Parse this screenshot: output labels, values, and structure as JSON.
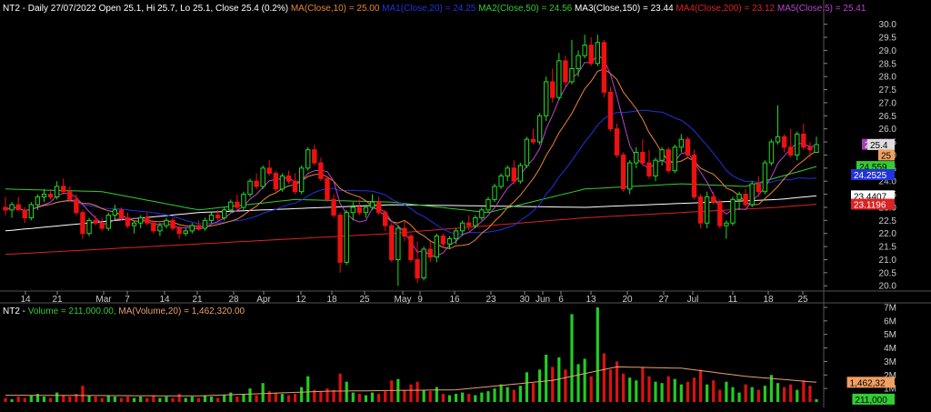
{
  "price_header": {
    "prefix": "NT2 - Daily 27/07/2022 Open 25.1, Hi 25.7, Lo 25.1, Close 25.4 (0.2%)",
    "ma_items": [
      {
        "text": "MA(Close,10) = 25.00",
        "color": "#e8843a"
      },
      {
        "text": "MA1(Close,20) = 24.25",
        "color": "#2233dd"
      },
      {
        "text": "MA2(Close,50) = 24.56",
        "color": "#33cc33"
      },
      {
        "text": "MA3(Close,150) = 23.44",
        "color": "#ffffff"
      },
      {
        "text": "MA4(Close,200) = 23.12",
        "color": "#dd2222"
      },
      {
        "text": "MA5(Close,5) = 25.41",
        "color": "#bb44cc"
      }
    ]
  },
  "volume_header": {
    "prefix": "NT2 - ",
    "items": [
      {
        "text": "Volume = 211,000.00,",
        "color": "#33cc33"
      },
      {
        "text": "MA(Volume,20) = 1,462,320.00",
        "color": "#e8a070"
      }
    ]
  },
  "chart_data": [
    {
      "type": "candlestick",
      "title": "NT2 - Daily",
      "x_tick_labels": [
        "14",
        "21",
        "Mar",
        "7",
        "14",
        "21",
        "28",
        "Apr",
        "12",
        "18",
        "25",
        "May",
        "9",
        "16",
        "23",
        "30",
        "Jun",
        "6",
        "13",
        "20",
        "27",
        "Jul",
        "11",
        "18",
        "25"
      ],
      "y_tick_labels": [
        "20.0",
        "20.5",
        "21.0",
        "21.5",
        "22.0",
        "22.5",
        "23.0",
        "23.5",
        "24.0",
        "24.5",
        "25.0",
        "25.5",
        "26.0",
        "26.5",
        "27.0",
        "27.5",
        "28.0",
        "28.5",
        "29.0",
        "29.5",
        "30.0"
      ],
      "ylim": [
        19.8,
        30.3
      ],
      "ohlc": [
        [
          23.0,
          23.4,
          22.7,
          22.9
        ],
        [
          22.9,
          23.2,
          22.6,
          23.1
        ],
        [
          23.1,
          23.4,
          22.9,
          22.9
        ],
        [
          22.9,
          23.0,
          22.4,
          22.6
        ],
        [
          22.6,
          23.2,
          22.5,
          23.1
        ],
        [
          23.1,
          23.5,
          22.9,
          23.4
        ],
        [
          23.4,
          23.7,
          23.2,
          23.5
        ],
        [
          23.5,
          23.7,
          23.3,
          23.4
        ],
        [
          23.4,
          24.0,
          23.3,
          23.8
        ],
        [
          23.8,
          24.1,
          23.5,
          23.6
        ],
        [
          23.6,
          23.8,
          23.2,
          23.3
        ],
        [
          23.3,
          23.5,
          22.7,
          22.8
        ],
        [
          22.8,
          22.9,
          21.8,
          22.0
        ],
        [
          22.0,
          22.6,
          21.9,
          22.5
        ],
        [
          22.5,
          22.7,
          22.3,
          22.4
        ],
        [
          22.4,
          22.6,
          22.1,
          22.2
        ],
        [
          22.2,
          22.8,
          22.1,
          22.7
        ],
        [
          22.7,
          23.1,
          22.5,
          22.9
        ],
        [
          22.9,
          23.0,
          22.5,
          22.6
        ],
        [
          22.6,
          22.8,
          22.2,
          22.3
        ],
        [
          22.3,
          22.5,
          22.0,
          22.4
        ],
        [
          22.4,
          22.7,
          22.2,
          22.6
        ],
        [
          22.6,
          22.8,
          22.3,
          22.4
        ],
        [
          22.4,
          22.5,
          22.0,
          22.1
        ],
        [
          22.1,
          22.4,
          21.9,
          22.3
        ],
        [
          22.3,
          22.6,
          22.2,
          22.5
        ],
        [
          22.5,
          22.6,
          22.1,
          22.2
        ],
        [
          22.2,
          22.3,
          21.8,
          22.0
        ],
        [
          22.0,
          22.2,
          21.9,
          22.1
        ],
        [
          22.1,
          22.4,
          22.0,
          22.3
        ],
        [
          22.3,
          22.5,
          22.1,
          22.2
        ],
        [
          22.2,
          22.6,
          22.1,
          22.5
        ],
        [
          22.5,
          22.8,
          22.4,
          22.7
        ],
        [
          22.7,
          22.9,
          22.5,
          22.6
        ],
        [
          22.6,
          23.0,
          22.5,
          22.9
        ],
        [
          22.9,
          23.3,
          22.8,
          23.2
        ],
        [
          23.2,
          23.5,
          22.9,
          23.0
        ],
        [
          23.0,
          23.6,
          22.9,
          23.5
        ],
        [
          23.5,
          24.1,
          23.4,
          24.0
        ],
        [
          24.0,
          24.3,
          23.7,
          23.8
        ],
        [
          23.8,
          24.6,
          23.7,
          24.5
        ],
        [
          24.5,
          24.8,
          24.2,
          24.3
        ],
        [
          24.3,
          24.4,
          23.6,
          23.7
        ],
        [
          23.7,
          24.3,
          23.6,
          24.2
        ],
        [
          24.2,
          24.4,
          23.9,
          24.0
        ],
        [
          24.0,
          24.3,
          23.5,
          23.6
        ],
        [
          23.6,
          24.6,
          23.5,
          24.5
        ],
        [
          24.5,
          25.3,
          24.4,
          25.2
        ],
        [
          25.2,
          25.4,
          24.6,
          24.7
        ],
        [
          24.7,
          24.9,
          24.0,
          24.1
        ],
        [
          24.1,
          24.2,
          23.2,
          23.3
        ],
        [
          23.3,
          23.5,
          22.6,
          22.7
        ],
        [
          22.7,
          22.8,
          20.5,
          20.9
        ],
        [
          20.9,
          22.9,
          20.8,
          22.8
        ],
        [
          22.8,
          23.2,
          22.5,
          23.0
        ],
        [
          23.0,
          23.3,
          22.7,
          22.8
        ],
        [
          22.8,
          23.1,
          22.6,
          23.0
        ],
        [
          23.0,
          23.5,
          22.9,
          23.2
        ],
        [
          23.2,
          23.4,
          22.7,
          22.8
        ],
        [
          22.8,
          22.9,
          22.1,
          22.3
        ],
        [
          22.3,
          22.4,
          20.9,
          21.0
        ],
        [
          21.0,
          22.3,
          20.0,
          22.2
        ],
        [
          22.2,
          22.5,
          21.7,
          21.9
        ],
        [
          21.9,
          22.0,
          20.9,
          21.0
        ],
        [
          21.0,
          21.7,
          20.1,
          20.3
        ],
        [
          20.3,
          21.5,
          20.2,
          21.4
        ],
        [
          21.4,
          21.7,
          20.9,
          21.1
        ],
        [
          21.1,
          22.0,
          20.9,
          21.9
        ],
        [
          21.9,
          22.0,
          21.5,
          21.6
        ],
        [
          21.6,
          21.9,
          21.4,
          21.8
        ],
        [
          21.8,
          22.2,
          21.6,
          22.1
        ],
        [
          22.1,
          22.5,
          21.9,
          22.4
        ],
        [
          22.4,
          22.7,
          22.1,
          22.3
        ],
        [
          22.3,
          22.7,
          22.2,
          22.6
        ],
        [
          22.6,
          23.0,
          22.5,
          22.9
        ],
        [
          22.9,
          23.4,
          22.8,
          23.3
        ],
        [
          23.3,
          23.9,
          23.2,
          23.8
        ],
        [
          23.8,
          24.3,
          23.7,
          24.2
        ],
        [
          24.2,
          24.6,
          24.0,
          24.5
        ],
        [
          24.5,
          24.8,
          23.9,
          24.0
        ],
        [
          24.0,
          24.7,
          23.9,
          24.6
        ],
        [
          24.6,
          25.7,
          24.5,
          25.6
        ],
        [
          25.6,
          26.0,
          25.4,
          25.5
        ],
        [
          25.5,
          26.6,
          25.4,
          26.5
        ],
        [
          26.5,
          28.0,
          26.3,
          27.8
        ],
        [
          27.8,
          28.3,
          27.0,
          27.2
        ],
        [
          27.2,
          28.9,
          27.1,
          28.6
        ],
        [
          28.6,
          28.8,
          27.6,
          27.8
        ],
        [
          27.8,
          29.4,
          27.7,
          28.3
        ],
        [
          28.3,
          29.0,
          28.0,
          28.8
        ],
        [
          28.8,
          29.6,
          28.7,
          29.2
        ],
        [
          29.2,
          29.5,
          28.4,
          28.5
        ],
        [
          28.5,
          29.6,
          28.4,
          29.3
        ],
        [
          29.3,
          29.4,
          27.2,
          27.4
        ],
        [
          27.4,
          27.6,
          25.9,
          26.0
        ],
        [
          26.0,
          26.2,
          24.9,
          25.0
        ],
        [
          25.0,
          25.1,
          23.6,
          23.7
        ],
        [
          23.7,
          24.8,
          23.5,
          24.7
        ],
        [
          24.7,
          25.3,
          24.5,
          25.1
        ],
        [
          25.1,
          25.6,
          24.6,
          24.7
        ],
        [
          24.7,
          25.2,
          24.1,
          24.2
        ],
        [
          24.2,
          24.9,
          24.0,
          24.8
        ],
        [
          24.8,
          25.3,
          24.6,
          25.2
        ],
        [
          25.2,
          25.3,
          24.3,
          24.4
        ],
        [
          24.4,
          25.4,
          24.3,
          25.3
        ],
        [
          25.3,
          25.8,
          25.1,
          25.6
        ],
        [
          25.6,
          25.7,
          24.9,
          25.0
        ],
        [
          25.0,
          25.2,
          23.3,
          23.4
        ],
        [
          23.4,
          23.5,
          22.2,
          22.4
        ],
        [
          22.4,
          23.6,
          22.2,
          23.4
        ],
        [
          23.4,
          23.6,
          23.1,
          23.2
        ],
        [
          23.2,
          23.3,
          22.2,
          22.3
        ],
        [
          22.3,
          22.5,
          21.8,
          22.4
        ],
        [
          22.4,
          23.4,
          22.3,
          23.3
        ],
        [
          23.3,
          23.6,
          22.9,
          23.5
        ],
        [
          23.5,
          23.7,
          23.0,
          23.1
        ],
        [
          23.1,
          24.0,
          23.0,
          23.9
        ],
        [
          23.9,
          24.2,
          23.4,
          23.6
        ],
        [
          23.6,
          24.8,
          23.5,
          24.7
        ],
        [
          24.7,
          25.6,
          24.6,
          25.5
        ],
        [
          25.5,
          26.9,
          25.4,
          25.7
        ],
        [
          25.7,
          25.8,
          25.1,
          25.3
        ],
        [
          25.3,
          26.0,
          24.9,
          25.0
        ],
        [
          25.0,
          25.9,
          24.8,
          25.8
        ],
        [
          25.8,
          26.2,
          25.2,
          25.3
        ],
        [
          25.3,
          25.5,
          24.9,
          25.2
        ],
        [
          25.1,
          25.7,
          25.1,
          25.4
        ]
      ],
      "series": [
        {
          "name": "MA(Close,10)",
          "color": "#e8843a"
        },
        {
          "name": "MA1(Close,20)",
          "color": "#2233dd"
        },
        {
          "name": "MA2(Close,50)",
          "color": "#33cc33"
        },
        {
          "name": "MA3(Close,150)",
          "color": "#ffffff"
        },
        {
          "name": "MA4(Close,200)",
          "color": "#dd2222"
        },
        {
          "name": "MA5(Close,5)",
          "color": "#bb44cc"
        }
      ],
      "ma_anchors": {
        "MA3(Close,150)": [
          [
            0,
            22.1
          ],
          [
            30,
            22.8
          ],
          [
            60,
            23.1
          ],
          [
            90,
            23.0
          ],
          [
            120,
            23.3
          ],
          [
            126,
            23.44
          ]
        ],
        "MA4(Close,200)": [
          [
            0,
            21.2
          ],
          [
            30,
            21.6
          ],
          [
            60,
            22.0
          ],
          [
            90,
            22.6
          ],
          [
            120,
            23.0
          ],
          [
            126,
            23.12
          ]
        ],
        "MA2(Close,50)": [
          [
            0,
            23.7
          ],
          [
            15,
            23.6
          ],
          [
            30,
            22.9
          ],
          [
            45,
            23.3
          ],
          [
            60,
            23.2
          ],
          [
            75,
            22.8
          ],
          [
            90,
            23.7
          ],
          [
            105,
            23.9
          ],
          [
            115,
            23.8
          ],
          [
            126,
            24.56
          ]
        ]
      },
      "price_flags": [
        {
          "label": "25.41",
          "value": 25.41,
          "bg": "#a040b0",
          "fg": "#ffffff"
        },
        {
          "label": "25.4",
          "value": 25.4,
          "bg": "#dddddd",
          "fg": "#000000"
        },
        {
          "label": "25",
          "value": 25.0,
          "bg": "#f0a060",
          "fg": "#000000"
        },
        {
          "label": "24.559",
          "value": 24.56,
          "bg": "#33cc33",
          "fg": "#000000"
        },
        {
          "label": "24.2525",
          "value": 24.25,
          "bg": "#2233dd",
          "fg": "#ffffff"
        },
        {
          "label": "23.4407",
          "value": 23.44,
          "bg": "#ffffff",
          "fg": "#000000"
        },
        {
          "label": "23.1196",
          "value": 23.12,
          "bg": "#dd2222",
          "fg": "#ffffff"
        }
      ]
    },
    {
      "type": "bar",
      "title": "Volume",
      "y_tick_labels": [
        "1M",
        "2M",
        "3M",
        "4M",
        "5M",
        "6M",
        "7M"
      ],
      "ylim": [
        0,
        7.2
      ],
      "unit": "millions",
      "volumes": [
        0.3,
        0.2,
        0.4,
        0.3,
        0.5,
        0.6,
        0.4,
        0.3,
        0.7,
        0.5,
        0.4,
        0.6,
        1.2,
        0.5,
        0.4,
        0.3,
        0.5,
        0.4,
        0.3,
        0.4,
        0.3,
        0.4,
        0.3,
        0.5,
        0.3,
        0.4,
        0.3,
        0.6,
        0.3,
        0.4,
        0.3,
        0.5,
        0.4,
        0.3,
        0.5,
        0.7,
        0.4,
        0.6,
        1.0,
        0.5,
        1.4,
        0.8,
        0.7,
        0.6,
        0.5,
        0.6,
        1.1,
        1.9,
        0.9,
        0.8,
        1.0,
        0.9,
        2.1,
        1.5,
        0.7,
        0.6,
        0.5,
        0.7,
        0.6,
        0.8,
        1.6,
        1.7,
        0.9,
        1.3,
        1.5,
        0.9,
        0.8,
        1.1,
        0.6,
        0.5,
        0.6,
        0.7,
        0.6,
        0.5,
        0.7,
        0.8,
        1.0,
        1.3,
        1.1,
        0.9,
        1.2,
        2.2,
        1.4,
        2.4,
        3.5,
        2.6,
        3.3,
        2.4,
        6.5,
        2.8,
        3.2,
        1.9,
        7.0,
        3.6,
        2.4,
        3.0,
        2.1,
        1.8,
        1.6,
        2.6,
        1.9,
        1.5,
        1.4,
        1.9,
        1.7,
        1.3,
        1.5,
        1.8,
        2.4,
        1.3,
        1.6,
        0.9,
        1.5,
        1.1,
        0.7,
        1.3,
        1.1,
        0.9,
        1.2,
        2.0,
        1.4,
        1.1,
        1.3,
        0.9,
        1.6,
        1.2,
        0.211
      ],
      "ma_volume_anchors": [
        [
          0,
          0.5
        ],
        [
          30,
          0.45
        ],
        [
          50,
          0.8
        ],
        [
          70,
          0.9
        ],
        [
          85,
          1.6
        ],
        [
          95,
          2.6
        ],
        [
          105,
          2.5
        ],
        [
          115,
          1.9
        ],
        [
          126,
          1.46
        ]
      ],
      "price_flags": [
        {
          "label": "1,462,32",
          "value": 1.46,
          "bg": "#f0a060",
          "fg": "#000000"
        },
        {
          "label": "211,000",
          "value": 0.211,
          "bg": "#33cc33",
          "fg": "#000000"
        }
      ]
    }
  ]
}
